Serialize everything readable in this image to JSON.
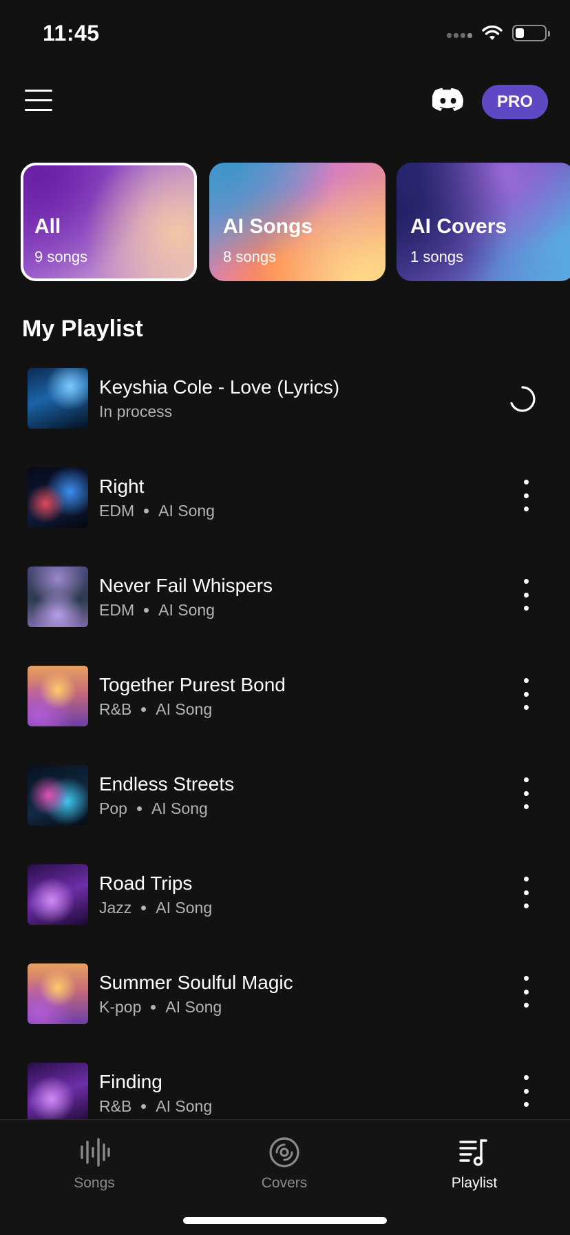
{
  "status_bar": {
    "time": "11:45"
  },
  "header": {
    "pro_label": "PRO"
  },
  "categories": [
    {
      "title": "All",
      "count": "9 songs",
      "selected": true
    },
    {
      "title": "AI Songs",
      "count": "8 songs",
      "selected": false
    },
    {
      "title": "AI Covers",
      "count": "1 songs",
      "selected": false
    }
  ],
  "playlist": {
    "title": "My Playlist",
    "tracks": [
      {
        "title": "Keyshia Cole - Love (Lyrics)",
        "status": "In process",
        "art": "blue-wave"
      },
      {
        "title": "Right",
        "genre": "EDM",
        "type": "AI Song",
        "art": "red-blue-wave"
      },
      {
        "title": "Never Fail Whispers",
        "genre": "EDM",
        "type": "AI Song",
        "art": "forest"
      },
      {
        "title": "Together Purest Bond",
        "genre": "R&B",
        "type": "AI Song",
        "art": "sunset-ice"
      },
      {
        "title": "Endless Streets",
        "genre": "Pop",
        "type": "AI Song",
        "art": "pink-cyan-wave"
      },
      {
        "title": "Road Trips",
        "genre": "Jazz",
        "type": "AI Song",
        "art": "purple-wave"
      },
      {
        "title": "Summer Soulful Magic",
        "genre": "K-pop",
        "type": "AI Song",
        "art": "sunset-ice"
      },
      {
        "title": "Finding",
        "genre": "R&B",
        "type": "AI Song",
        "art": "purple-wave"
      }
    ]
  },
  "bottom_nav": {
    "items": [
      {
        "label": "Songs",
        "icon": "waveform-icon",
        "active": false
      },
      {
        "label": "Covers",
        "icon": "disc-icon",
        "active": false
      },
      {
        "label": "Playlist",
        "icon": "playlist-music-icon",
        "active": true
      }
    ]
  },
  "colors": {
    "background": "#121212",
    "accent": "#5e48c4",
    "muted_text": "#b3b3b3"
  }
}
